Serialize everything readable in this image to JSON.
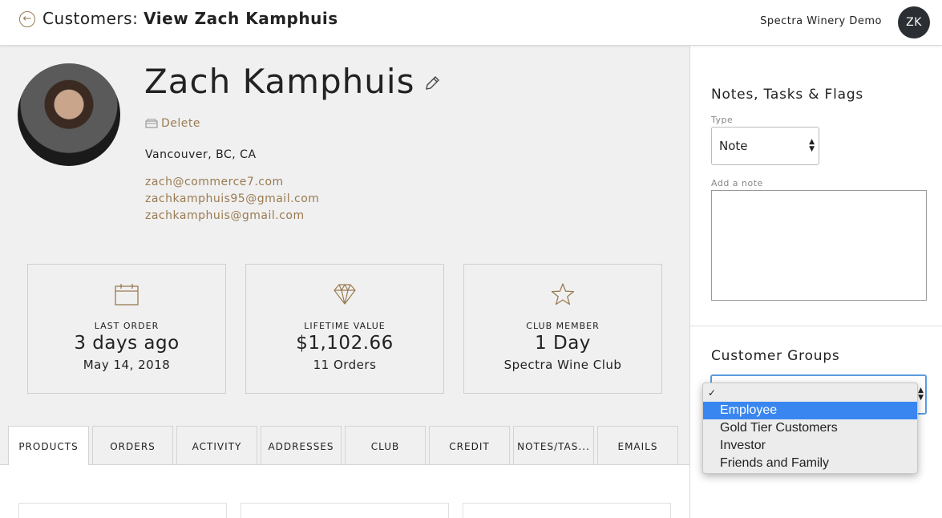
{
  "header": {
    "title_prefix": "Customers:",
    "title_bold": "View Zach Kamphuis",
    "org_name": "Spectra Winery Demo",
    "user_initials": "ZK"
  },
  "customer": {
    "name": "Zach Kamphuis",
    "delete_label": "Delete",
    "location": "Vancouver, BC, CA",
    "emails": [
      "zach@commerce7.com",
      "zachkamphuis95@gmail.com",
      "zachkamphuis@gmail.com"
    ]
  },
  "stats": [
    {
      "icon": "calendar-icon",
      "label": "LAST ORDER",
      "value": "3 days ago",
      "sub": "May 14, 2018"
    },
    {
      "icon": "diamond-icon",
      "label": "LIFETIME VALUE",
      "value": "$1,102.66",
      "sub": "11 Orders"
    },
    {
      "icon": "star-icon",
      "label": "CLUB MEMBER",
      "value": "1 Day",
      "sub": "Spectra Wine Club"
    }
  ],
  "tabs": [
    "PRODUCTS",
    "ORDERS",
    "ACTIVITY",
    "ADDRESSES",
    "CLUB",
    "CREDIT",
    "NOTES/TAS...",
    "EMAILS"
  ],
  "active_tab": "PRODUCTS",
  "sidebar": {
    "notes_title": "Notes, Tasks & Flags",
    "type_label": "Type",
    "type_value": "Note",
    "note_label": "Add a note",
    "groups_title": "Customer Groups"
  },
  "group_dropdown": {
    "check": "✓",
    "options": [
      "Employee",
      "Gold Tier Customers",
      "Investor",
      "Friends and Family"
    ],
    "highlighted": "Employee"
  },
  "colors": {
    "accent": "#9a7b52",
    "highlight": "#3a86f0",
    "background": "#f0f0f0"
  }
}
